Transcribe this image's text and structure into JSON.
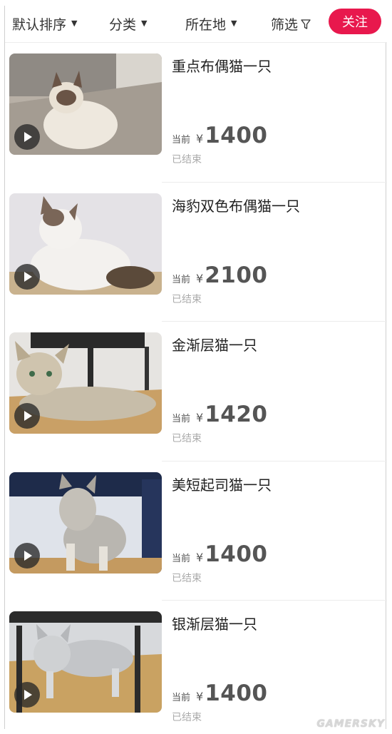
{
  "filters": {
    "sort": "默认排序",
    "category": "分类",
    "location": "所在地",
    "filter": "筛选",
    "follow": "关注"
  },
  "colors": {
    "accent": "#e8184d"
  },
  "items": [
    {
      "title": "重点布偶猫一只",
      "price_label": "当前",
      "currency": "¥",
      "price": "1400",
      "status": "已结束"
    },
    {
      "title": "海豹双色布偶猫一只",
      "price_label": "当前",
      "currency": "¥",
      "price": "2100",
      "status": "已结束"
    },
    {
      "title": "金渐层猫一只",
      "price_label": "当前",
      "currency": "¥",
      "price": "1420",
      "status": "已结束"
    },
    {
      "title": "美短起司猫一只",
      "price_label": "当前",
      "currency": "¥",
      "price": "1400",
      "status": "已结束"
    },
    {
      "title": "银渐层猫一只",
      "price_label": "当前",
      "currency": "¥",
      "price": "1400",
      "status": "已结束"
    }
  ],
  "watermark": "GAMERSKY"
}
